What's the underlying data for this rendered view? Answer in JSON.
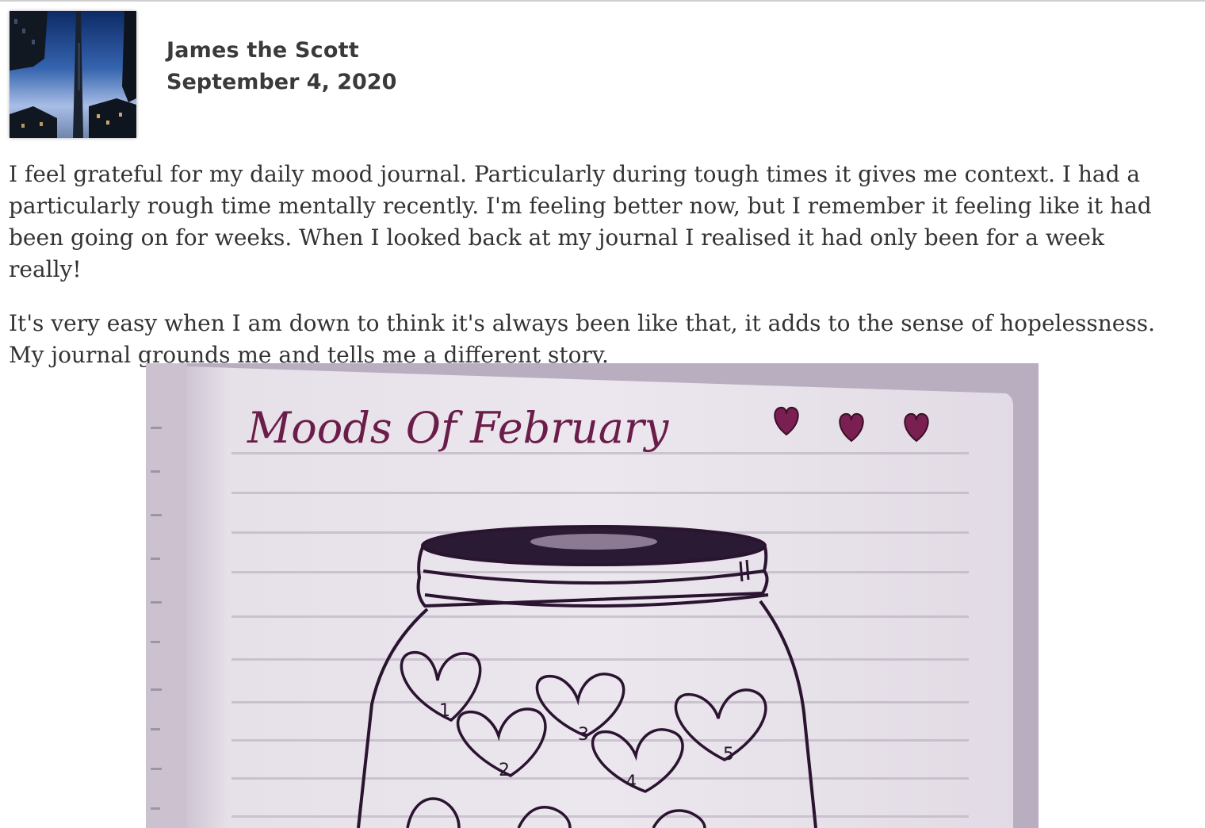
{
  "post": {
    "author": "James the Scott",
    "date": "September 4, 2020",
    "paragraphs": [
      "I feel grateful for my daily mood journal. Particularly during tough times it gives me context. I had a particularly rough time mentally recently. I'm feeling better now, but I remember it feeling like it had been going on for weeks. When I looked back at my journal I realised it had only been for a week really!",
      "It's very easy when I am down to think it's always been like that, it adds to the sense of hopelessness. My journal grounds me and tells me a different story."
    ]
  },
  "image": {
    "title": "Moods Of February",
    "heart_numbers": [
      "1",
      "2",
      "3",
      "4",
      "5"
    ],
    "colors": {
      "ink": "#2a1430",
      "title_ink": "#6b1d4a",
      "heart_fill": "#7a1f52",
      "page": "#e8e2ea"
    }
  },
  "colors": {
    "text": "#333333",
    "heading": "#3a3a3a",
    "rule": "#cfcfcf"
  }
}
